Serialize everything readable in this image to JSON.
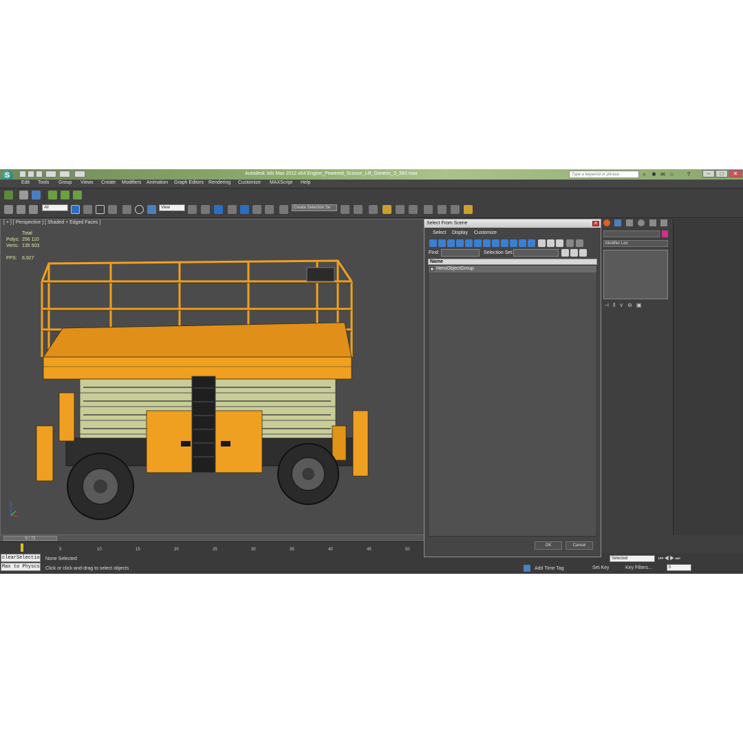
{
  "window": {
    "title": "Autodesk 3ds Max  2012 x64      Engine_Powered_Scissor_Lift_Generic_3_360.max",
    "search_placeholder": "Type a keyword or phrase"
  },
  "menu": [
    "Edit",
    "Tools",
    "Group",
    "Views",
    "Create",
    "Modifiers",
    "Animation",
    "Graph Editors",
    "Rendering",
    "Customize",
    "MAXScript",
    "Help"
  ],
  "toolbar": {
    "filter_value": "All",
    "coord_value": "View",
    "selection_set_value": "Create Selection Se"
  },
  "viewport": {
    "label": "[ + ] [ Perspective ] [ Shaded + Edged Faces ]",
    "stats": {
      "total_label": "Total",
      "polys_label": "Polys:",
      "polys_value": "256 110",
      "verts_label": "Verts:",
      "verts_value": "135 503",
      "fps_label": "FPS:",
      "fps_value": "6,927"
    },
    "axis_x": "x",
    "axis_y": "y",
    "axis_z": "z"
  },
  "timeline": {
    "slider": "0 / 72",
    "ticks": [
      "5",
      "10",
      "15",
      "20",
      "25",
      "30",
      "35",
      "40",
      "45",
      "50"
    ]
  },
  "status": {
    "maxscript_line1": "clearSelectio",
    "maxscript_line2": "Max to Physcs",
    "selected_text": "None Selected",
    "prompt_text": "Click or click-and-drag to select objects",
    "add_time_tag": "Add Time Tag",
    "set_key": "Set Key",
    "key_filters": "Key Filters...",
    "selected_dropdown": "Selected",
    "frame_value": "0"
  },
  "command_panel": {
    "modifier_list": "Modifier List"
  },
  "dialog": {
    "title": "Select From Scene",
    "menus": [
      "Select",
      "Display",
      "Customize"
    ],
    "find_label": "Find:",
    "selection_set_label": "Selection Set:",
    "column_name": "Name",
    "items": [
      "HeroObjectGroup"
    ],
    "ok": "OK",
    "cancel": "Cancel"
  },
  "colors": {
    "lift_orange": "#f0a020",
    "wireframe": "#3a2a10",
    "viewport_bg": "#4b4b4b",
    "accent_blue": "#2b6fc2"
  }
}
